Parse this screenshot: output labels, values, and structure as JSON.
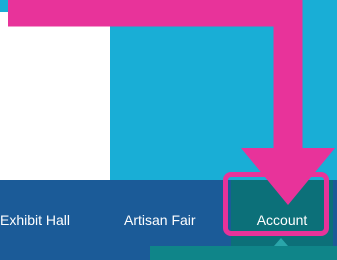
{
  "nav": {
    "items": [
      {
        "label": "Exhibit Hall"
      },
      {
        "label": "Artisan Fair"
      },
      {
        "label": "Account"
      }
    ]
  },
  "colors": {
    "cyan": "#19aed6",
    "navbar": "#1b5b98",
    "active": "#0c7079",
    "highlight": "#e8339a"
  },
  "icons": {
    "annotation": "arrow-down-right-icon"
  }
}
